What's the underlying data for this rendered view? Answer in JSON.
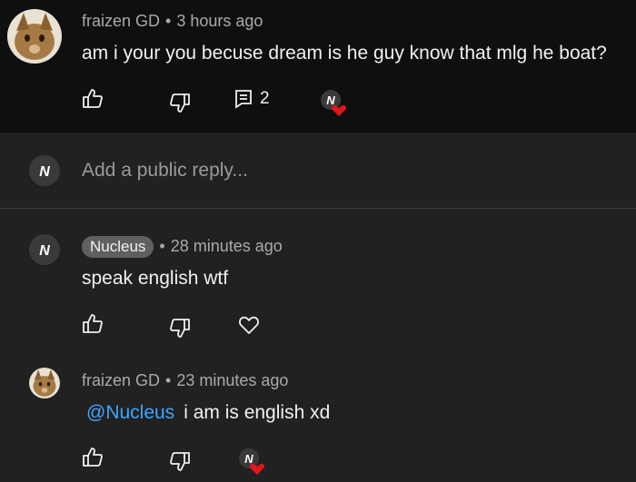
{
  "thread": {
    "original": {
      "author": "fraizen GD",
      "time": "3 hours ago",
      "text": "am i your you becuse dream is he guy know that mlg he boat?",
      "reply_count": "2"
    },
    "reply_box": {
      "placeholder": "Add a public reply..."
    },
    "replies": [
      {
        "author": "Nucleus",
        "time": "28 minutes ago",
        "text": "speak english wtf"
      },
      {
        "author": "fraizen GD",
        "time": "23 minutes ago",
        "mention": "@Nucleus",
        "text": "i am is english xd"
      }
    ]
  },
  "colors": {
    "top_background": "#0f0f0f",
    "thread_background": "#212121",
    "mention": "#3ea6ff",
    "heart": "#e0161d"
  },
  "icons": [
    "thumbs-up-icon",
    "thumbs-down-icon",
    "reply-comment-icon",
    "heart-icon",
    "creator-heart-icon"
  ],
  "separator": "•"
}
